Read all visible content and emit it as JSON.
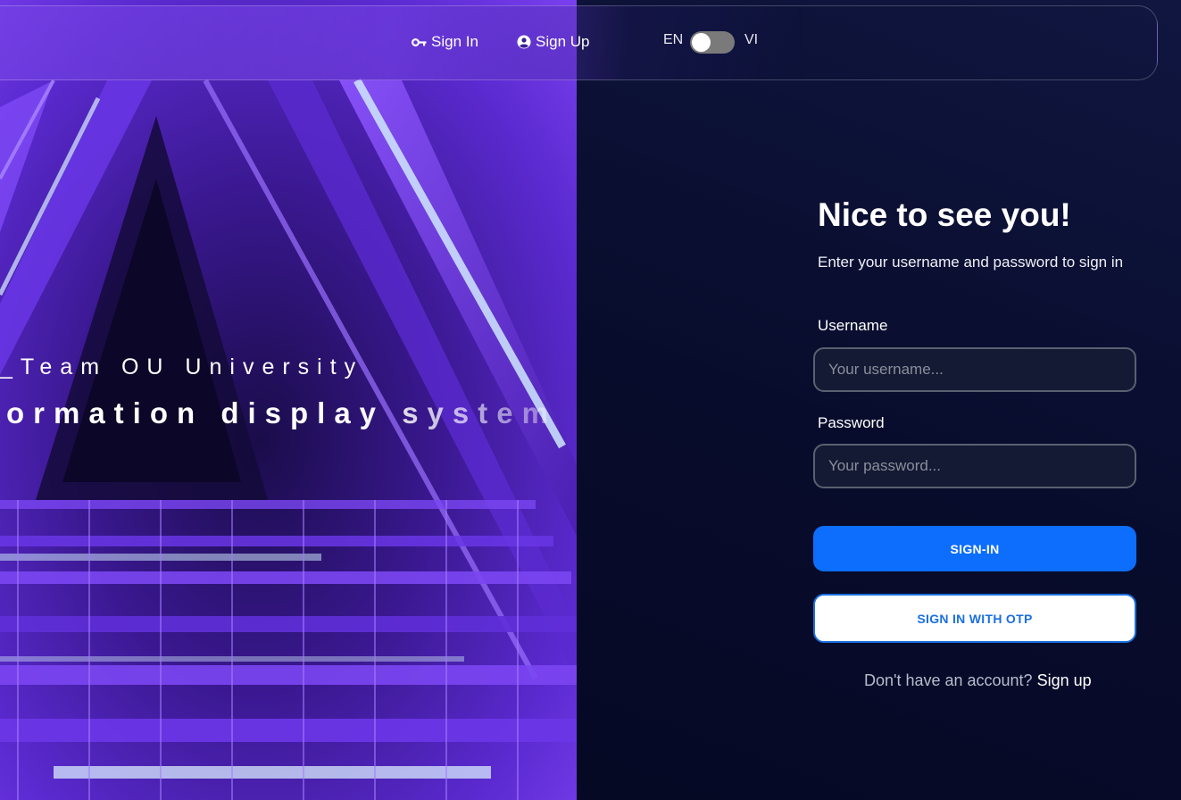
{
  "nav": {
    "signin_label": "Sign In",
    "signup_label": "Sign Up",
    "lang_left": "EN",
    "lang_right": "VI"
  },
  "hero": {
    "line1": "_Team OU University",
    "line2": "formation display system"
  },
  "form": {
    "title": "Nice to see you!",
    "subtitle": "Enter your username and password to sign in",
    "username_label": "Username",
    "username_placeholder": "Your username...",
    "password_label": "Password",
    "password_placeholder": "Your password...",
    "signin_button": "SIGN-IN",
    "otp_button": "SIGN IN WITH OTP",
    "no_account_text": "Don't have an account?",
    "signup_link": "Sign up"
  },
  "icons": {
    "signin": "key-icon",
    "signup": "user-circle-icon"
  },
  "colors": {
    "primary": "#0d6efd",
    "background": "#080c2c",
    "hero_purple": "#6a35e0"
  }
}
